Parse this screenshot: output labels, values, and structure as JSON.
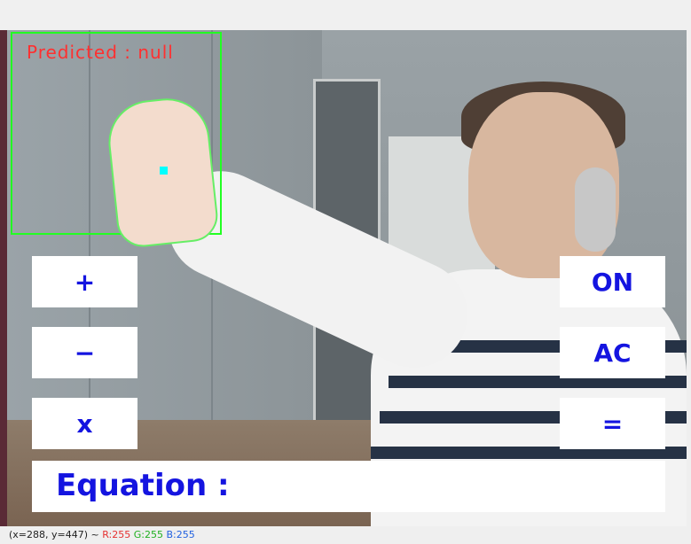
{
  "video": {
    "predicted_text": "Predicted : null"
  },
  "buttons": {
    "plus": "+",
    "minus": "−",
    "times": "x",
    "on": "ON",
    "ac": "AC",
    "equals": "="
  },
  "equation": {
    "label": "Equation :"
  },
  "status_bar": {
    "coords": "(x=288, y=447) ~",
    "r": "R:255",
    "g": "G:255",
    "b": "B:255"
  },
  "colors": {
    "button_text": "#1414e0",
    "roi_border": "#22ff22",
    "predicted_text": "#ff3030",
    "cursor_dot": "#00ffff"
  }
}
